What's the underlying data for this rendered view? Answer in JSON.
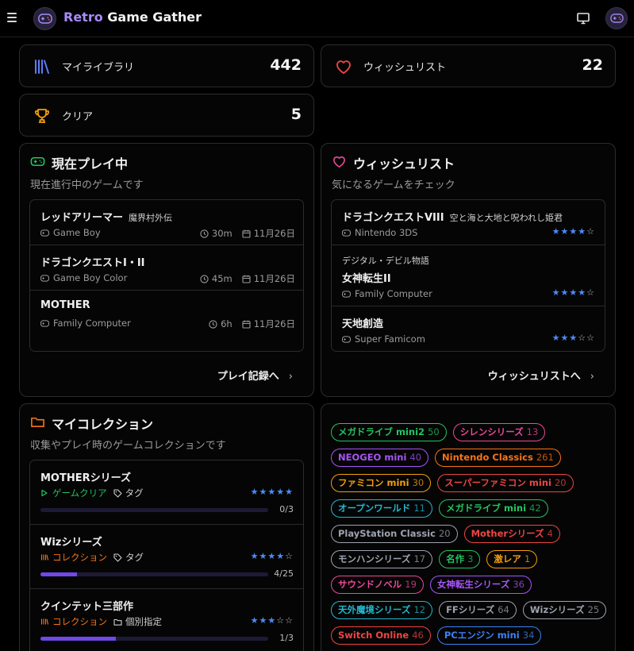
{
  "header": {
    "title_part1": "Retro",
    "title_part2": "Game Gather"
  },
  "stats": [
    {
      "label": "マイライブラリ",
      "value": "442"
    },
    {
      "label": "ウィッシュリスト",
      "value": "22"
    },
    {
      "label": "クリア",
      "value": "5"
    }
  ],
  "playing": {
    "title": "現在プレイ中",
    "subtitle": "現在進行中のゲームです",
    "games": [
      {
        "title": "レッドアリーマー",
        "subtitle": "魔界村外伝",
        "platform": "Game Boy",
        "time": "30m",
        "date": "11月26日"
      },
      {
        "title": "ドラゴンクエストI・II",
        "subtitle": "",
        "platform": "Game Boy Color",
        "time": "45m",
        "date": "11月26日"
      },
      {
        "title": "MOTHER",
        "subtitle": "",
        "platform": "Family Computer",
        "time": "6h",
        "date": "11月26日"
      }
    ],
    "link": "プレイ記録へ"
  },
  "wishlist": {
    "title": "ウィッシュリスト",
    "subtitle": "気になるゲームをチェック",
    "games": [
      {
        "title": "ドラゴンクエストVIII",
        "subtitle": "空と海と大地と呪われし姫君",
        "pretitle": "",
        "platform": "Nintendo 3DS",
        "rating": 4
      },
      {
        "title": "女神転生II",
        "subtitle": "",
        "pretitle": "デジタル・デビル物語",
        "platform": "Family Computer",
        "rating": 4
      },
      {
        "title": "天地創造",
        "subtitle": "",
        "pretitle": "",
        "platform": "Super Famicom",
        "rating": 3
      }
    ],
    "link": "ウィッシュリストへ"
  },
  "collections": {
    "title": "マイコレクション",
    "subtitle": "収集やプレイ時のゲームコレクションです",
    "items": [
      {
        "name": "MOTHERシリーズ",
        "kind": "ゲームクリア",
        "kind_color": "#22c55e",
        "tag": "タグ",
        "rating": 5,
        "progress": 0.0,
        "count": "0/3"
      },
      {
        "name": "Wizシリーズ",
        "kind": "コレクション",
        "kind_color": "#f97316",
        "tag": "タグ",
        "rating": 4,
        "progress": 0.16,
        "count": "4/25"
      },
      {
        "name": "クインテット三部作",
        "kind": "コレクション",
        "kind_color": "#f97316",
        "tag": "個別指定",
        "rating": 3,
        "progress": 0.33,
        "count": "1/3"
      }
    ]
  },
  "tags": [
    {
      "name": "メガドライブ mini2",
      "count": "50",
      "color": "#22c55e"
    },
    {
      "name": "シレンシリーズ",
      "count": "13",
      "color": "#ec4899"
    },
    {
      "name": "NEOGEO mini",
      "count": "40",
      "color": "#a855f7"
    },
    {
      "name": "Nintendo Classics",
      "count": "261",
      "color": "#f97316"
    },
    {
      "name": "ファミコン mini",
      "count": "30",
      "color": "#f59e0b"
    },
    {
      "name": "スーパーファミコン mini",
      "count": "20",
      "color": "#ef4444"
    },
    {
      "name": "オープンワールド",
      "count": "11",
      "color": "#22b8cf"
    },
    {
      "name": "メガドライブ mini",
      "count": "42",
      "color": "#22c55e"
    },
    {
      "name": "PlayStation Classic",
      "count": "20",
      "color": "#9ca3af"
    },
    {
      "name": "Motherシリーズ",
      "count": "4",
      "color": "#ef4444"
    },
    {
      "name": "モンハンシリーズ",
      "count": "17",
      "color": "#9ca3af"
    },
    {
      "name": "名作",
      "count": "3",
      "color": "#22c55e"
    },
    {
      "name": "激レア",
      "count": "1",
      "color": "#f59e0b"
    },
    {
      "name": "サウンドノベル",
      "count": "19",
      "color": "#ec4899"
    },
    {
      "name": "女神転生シリーズ",
      "count": "36",
      "color": "#a855f7"
    },
    {
      "name": "天外魔境シリーズ",
      "count": "12",
      "color": "#22b8cf"
    },
    {
      "name": "FFシリーズ",
      "count": "64",
      "color": "#9ca3af"
    },
    {
      "name": "Wizシリーズ",
      "count": "25",
      "color": "#9ca3af"
    },
    {
      "name": "Switch Online",
      "count": "46",
      "color": "#ef4444"
    },
    {
      "name": "PCエンジン mini",
      "count": "34",
      "color": "#3b82f6"
    }
  ],
  "icons": {
    "menu": "hamburger-icon",
    "logo": "gamepad-icon",
    "monitor": "monitor-icon",
    "library": "library-icon",
    "wishlist": "heart-icon",
    "clear": "trophy-icon",
    "folder": "folder-icon",
    "clock": "clock-icon",
    "calendar": "calendar-icon",
    "tag": "tag-icon"
  }
}
